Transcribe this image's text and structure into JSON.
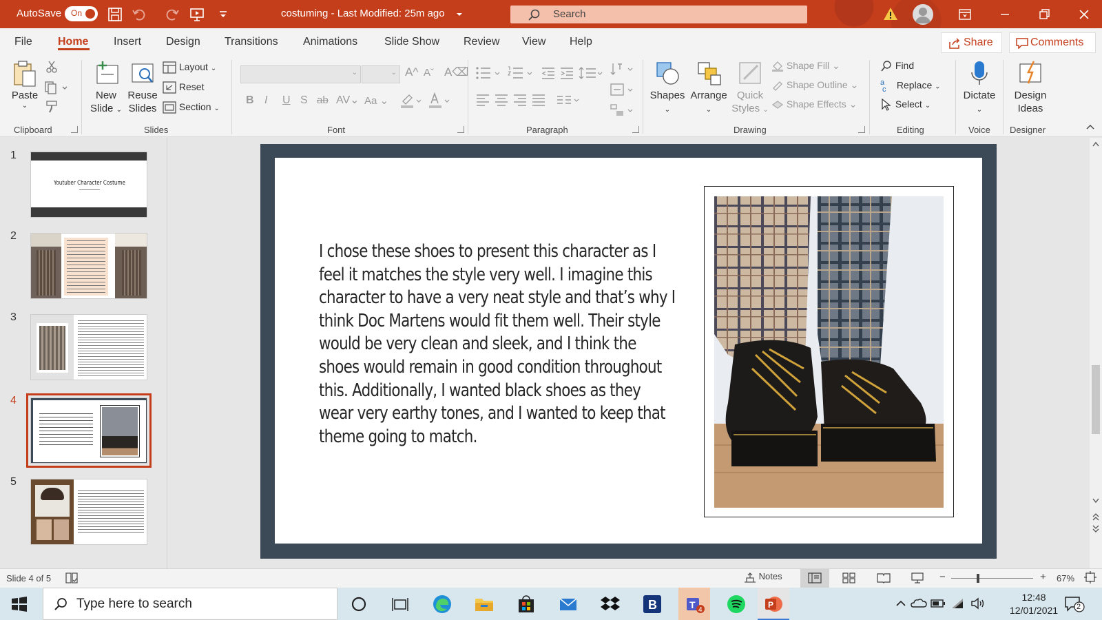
{
  "titlebar": {
    "autosave_label": "AutoSave",
    "autosave_state": "On",
    "doc_title": "costuming  -  Last Modified: 25m ago",
    "search_placeholder": "Search",
    "accent": "#c43e1c"
  },
  "tabs": [
    "File",
    "Home",
    "Insert",
    "Design",
    "Transitions",
    "Animations",
    "Slide Show",
    "Review",
    "View",
    "Help"
  ],
  "active_tab": "Home",
  "share_label": "Share",
  "comments_label": "Comments",
  "ribbon": {
    "clipboard": {
      "paste": "Paste",
      "group": "Clipboard"
    },
    "slides": {
      "new_slide_1": "New",
      "new_slide_2": "Slide",
      "reuse_1": "Reuse",
      "reuse_2": "Slides",
      "layout": "Layout",
      "reset": "Reset",
      "section": "Section",
      "group": "Slides"
    },
    "font": {
      "bold": "B",
      "italic": "I",
      "underline": "U",
      "shadow": "S",
      "strike": "ab",
      "case": "Aa",
      "group": "Font"
    },
    "paragraph": {
      "group": "Paragraph"
    },
    "drawing": {
      "shapes": "Shapes",
      "arrange": "Arrange",
      "quick_1": "Quick",
      "quick_2": "Styles",
      "shape_fill": "Shape Fill",
      "shape_outline": "Shape Outline",
      "shape_effects": "Shape Effects",
      "group": "Drawing"
    },
    "editing": {
      "find": "Find",
      "replace": "Replace",
      "select": "Select",
      "group": "Editing"
    },
    "voice": {
      "dictate": "Dictate",
      "group": "Voice"
    },
    "designer": {
      "ideas_1": "Design",
      "ideas_2": "Ideas",
      "group": "Designer"
    }
  },
  "thumbnails": [
    {
      "num": "1",
      "title": "Youtuber Character Costume"
    },
    {
      "num": "2"
    },
    {
      "num": "3"
    },
    {
      "num": "4",
      "selected": true
    },
    {
      "num": "5"
    }
  ],
  "slide": {
    "body_text": "I chose these shoes to present this character as I feel it matches the style very well. I imagine this character to have a very neat style and that’s why I think Doc Martens would fit them well. Their style would be very clean and sleek, and I think the shoes would remain in good condition throughout this. Additionally, I wanted black shoes as they wear very earthy tones, and I wanted to keep that theme going to match.",
    "frame_color": "#3c4a58"
  },
  "status": {
    "slide_info": "Slide 4 of 5",
    "notes": "Notes",
    "zoom": "67%"
  },
  "taskbar": {
    "search_placeholder": "Type here to search",
    "time": "12:48",
    "date": "12/01/2021",
    "notification_count": "2"
  }
}
